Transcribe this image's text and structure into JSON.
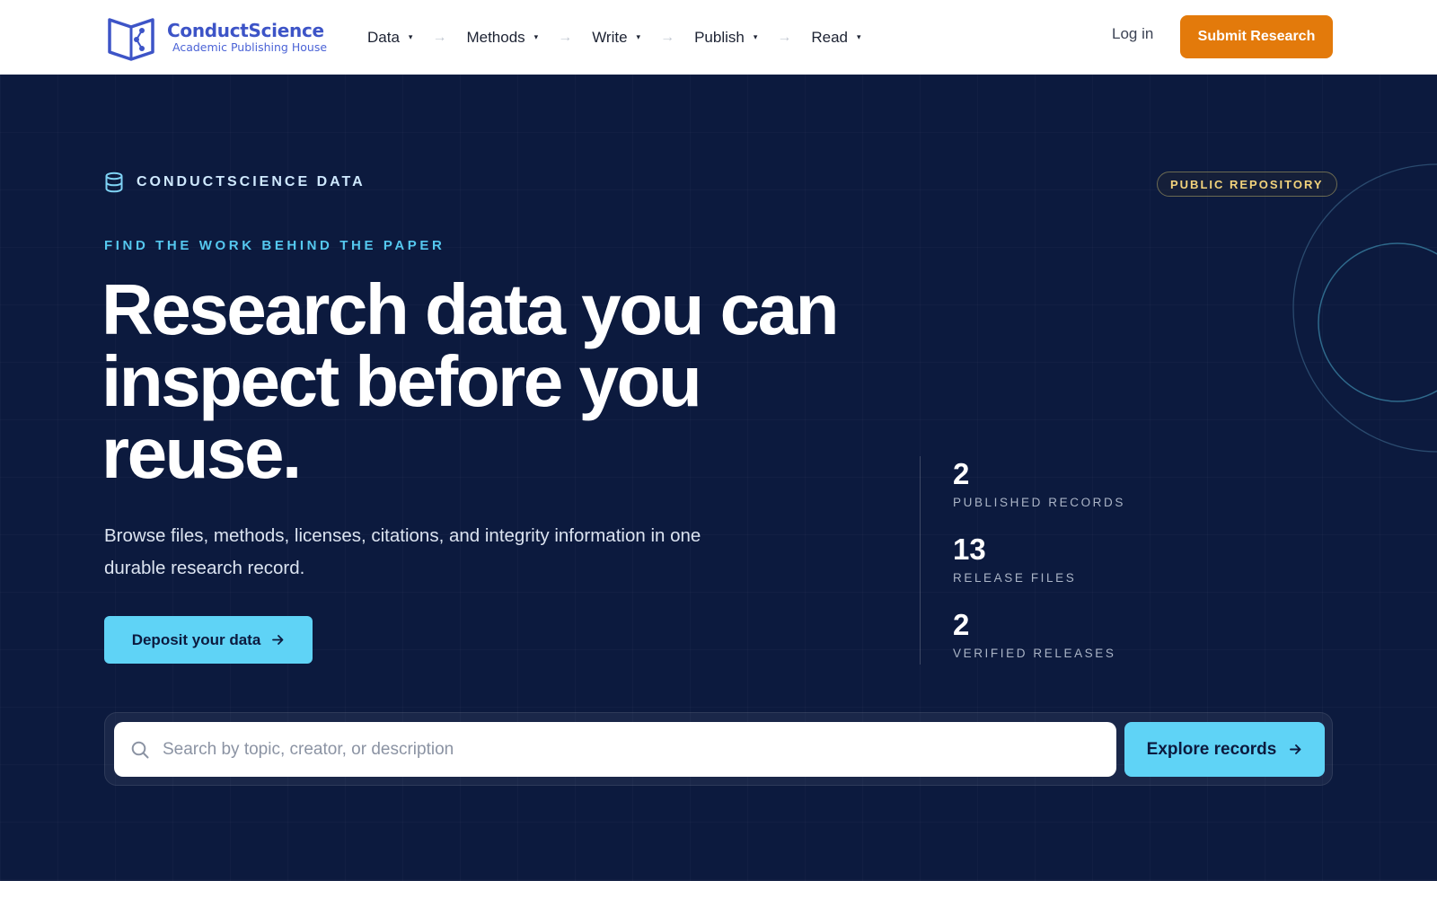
{
  "brand": {
    "name": "ConductScience",
    "tagline": "Academic Publishing House"
  },
  "nav": {
    "items": [
      {
        "label": "Data"
      },
      {
        "label": "Methods"
      },
      {
        "label": "Write"
      },
      {
        "label": "Publish"
      },
      {
        "label": "Read"
      }
    ],
    "separator": "→",
    "dropdown_glyph": "▾",
    "login_label": "Log in",
    "cta_label": "Submit Research"
  },
  "hero": {
    "eyebrow": "CONDUCTSCIENCE DATA",
    "badge": "PUBLIC REPOSITORY",
    "kicker": "FIND THE WORK BEHIND THE PAPER",
    "headline": "Research data you can inspect before you reuse.",
    "lead": "Browse files, methods, licenses, citations, and integrity information in one durable research record.",
    "deposit_label": "Deposit your data"
  },
  "stats": [
    {
      "value": "2",
      "label": "PUBLISHED RECORDS"
    },
    {
      "value": "13",
      "label": "RELEASE FILES"
    },
    {
      "value": "2",
      "label": "VERIFIED RELEASES"
    }
  ],
  "search": {
    "placeholder": "Search by topic, creator, or description",
    "value": "",
    "button_label": "Explore records"
  },
  "icons": {
    "logo": "open-book-share-icon",
    "eyebrow": "database-icon",
    "search": "search-icon",
    "arrow": "arrow-right-icon"
  },
  "colors": {
    "brand": "#3d54c7",
    "cta_orange": "#e37a0b",
    "hero_bg": "#0c1a3e",
    "accent_cyan": "#5fd3f6",
    "badge_gold": "#f2d37c"
  }
}
